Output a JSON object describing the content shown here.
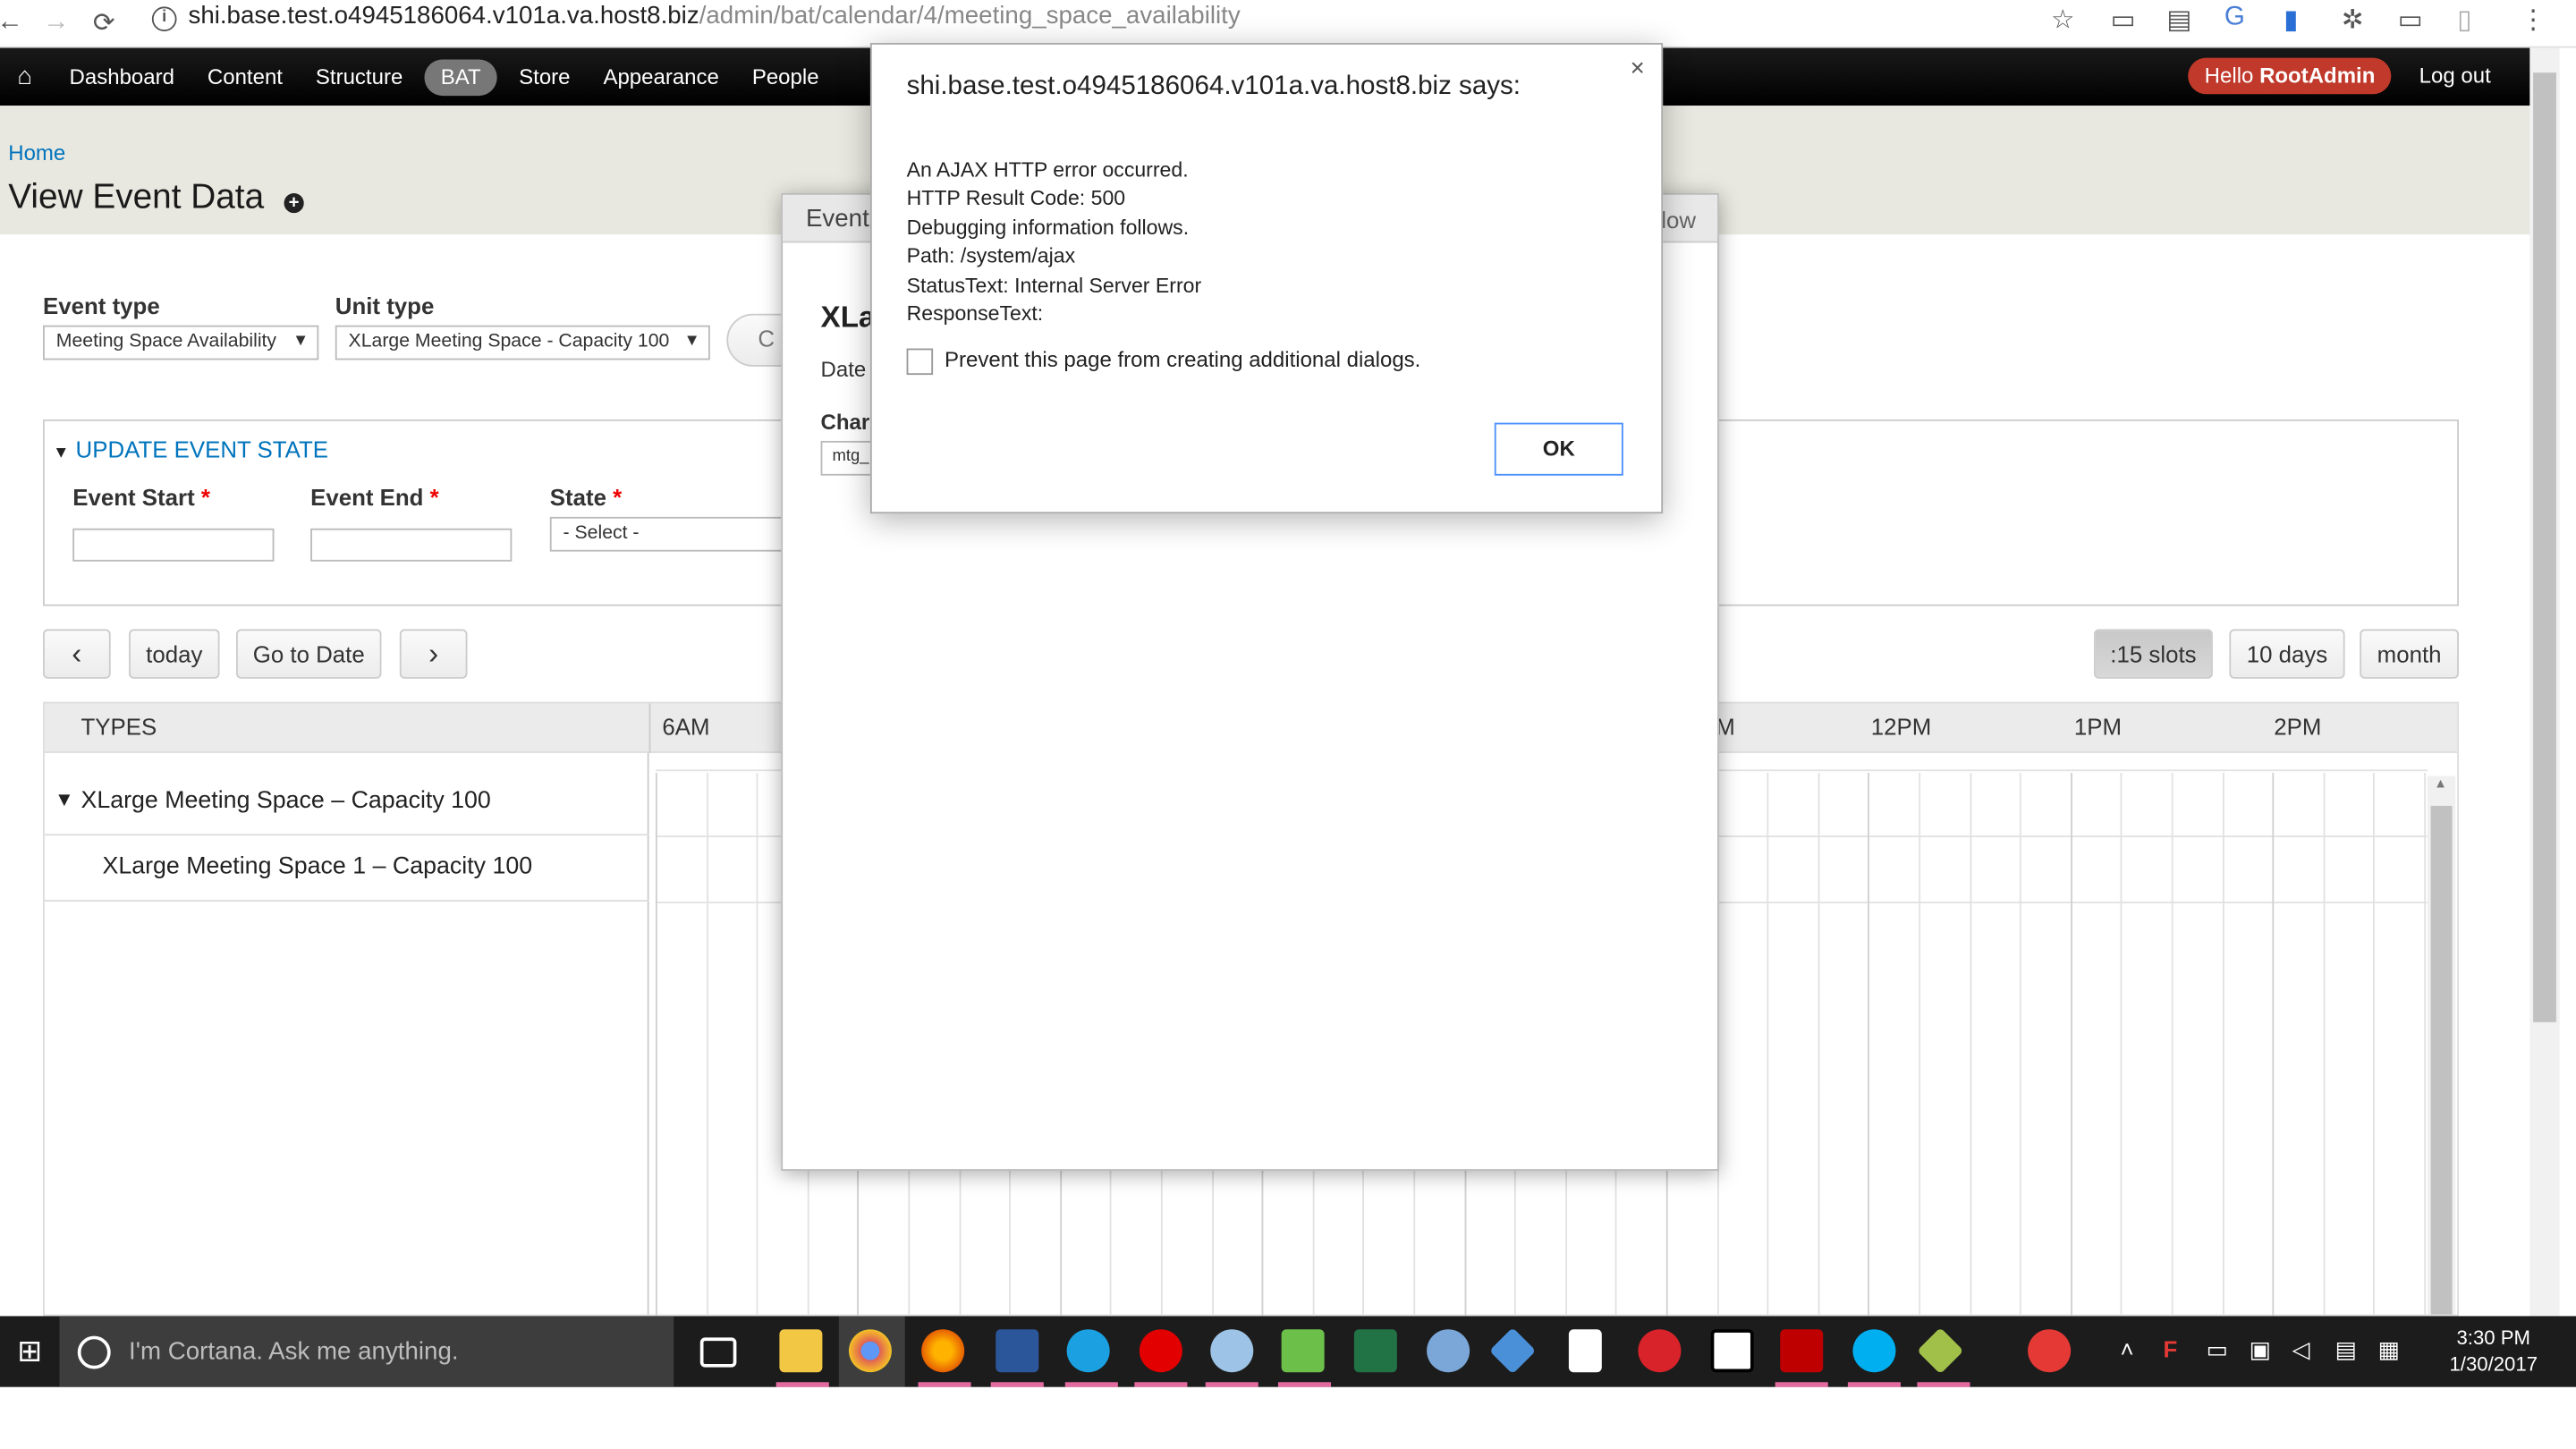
{
  "browser": {
    "url_host": "shi.base.test.o4945186064.v101a.va.host8.biz",
    "url_path": "/admin/bat/calendar/4/meeting_space_availability"
  },
  "toolbar": {
    "items": [
      "Dashboard",
      "Content",
      "Structure",
      "BAT",
      "Store",
      "Appearance",
      "People"
    ],
    "hello_prefix": "Hello ",
    "hello_user": "RootAdmin",
    "logout": "Log out"
  },
  "page": {
    "breadcrumb": "Home",
    "title": "View Event Data"
  },
  "filters": {
    "event_type_label": "Event type",
    "event_type_value": "Meeting Space Availability",
    "unit_type_label": "Unit type",
    "unit_type_value": "XLarge Meeting Space - Capacity 100",
    "partial_button": "C"
  },
  "update_state": {
    "legend": "UPDATE EVENT STATE",
    "event_start": "Event Start",
    "event_end": "Event End",
    "state": "State",
    "required_mark": "*",
    "state_placeholder": "- Select -"
  },
  "calendar_nav": {
    "prev": "‹",
    "today": "today",
    "goto": "Go to Date",
    "next": "›",
    "slots": ":15 slots",
    "ten_days": "10 days",
    "month": "month"
  },
  "calendar": {
    "types_header": "TYPES",
    "times": [
      "6AM",
      "M",
      "12PM",
      "1PM",
      "2PM"
    ],
    "group": "XLarge Meeting Space – Capacity 100",
    "unit": "XLarge Meeting Space 1 – Capacity 100"
  },
  "modal": {
    "title": "Event",
    "title_right": "low",
    "heading": "XLa",
    "date_label": "Date",
    "char_label": "Char",
    "input_value": "mtg_"
  },
  "alert": {
    "title": "shi.base.test.o4945186064.v101a.va.host8.biz says:",
    "lines": [
      "An AJAX HTTP error occurred.",
      "HTTP Result Code: 500",
      "Debugging information follows.",
      "Path: /system/ajax",
      "StatusText: Internal Server Error",
      "ResponseText:"
    ],
    "checkbox_label": "Prevent this page from creating additional dialogs.",
    "ok": "OK",
    "close": "×"
  },
  "taskbar": {
    "cortana": "I'm Cortana. Ask me anything.",
    "time": "3:30 PM",
    "date": "1/30/2017"
  },
  "colors": {
    "link": "#0074bd",
    "toolbar": "#000000",
    "hello_badge": "#c0392b",
    "header_bg": "#e8e8e0"
  }
}
